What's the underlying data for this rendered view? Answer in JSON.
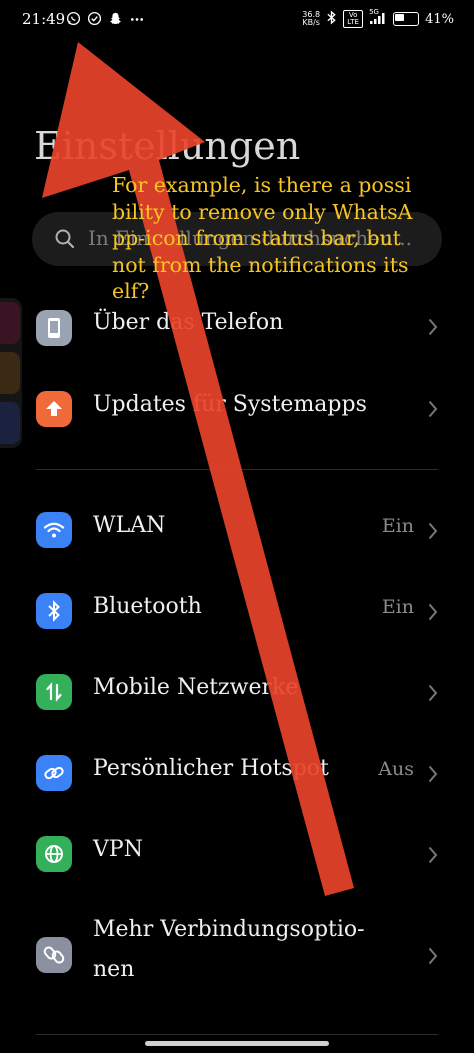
{
  "status_bar": {
    "time": "21:49",
    "net_speed_value": "36.8",
    "net_speed_unit": "KB/s",
    "volte": "Vo LTE",
    "signal": "5G",
    "battery": "41%",
    "battery_level": 0.41,
    "left_icons": [
      "whatsapp-icon",
      "check-circle-icon",
      "snapchat-icon",
      "more-dots-icon"
    ],
    "right_icons": [
      "bluetooth-icon",
      "wifi-icon",
      "signal-icon",
      "battery-icon"
    ]
  },
  "page": {
    "title": "Einstellungen"
  },
  "search": {
    "placeholder": "In Einstellungen durchsuchen..."
  },
  "groups": [
    {
      "items": [
        {
          "label": "Über das Telefon",
          "icon": "phone-icon",
          "color": "#9aa3b2"
        },
        {
          "label": "Updates für Systemapps",
          "icon": "update-arrow-icon",
          "color": "#f06a3a"
        }
      ]
    },
    {
      "items": [
        {
          "label": "WLAN",
          "value": "Ein",
          "icon": "wifi-icon",
          "color": "#3b82f6"
        },
        {
          "label": "Bluetooth",
          "value": "Ein",
          "icon": "bluetooth-icon",
          "color": "#3b82f6"
        },
        {
          "label": "Mobile Netzwerke",
          "icon": "mobile-data-icon",
          "color": "#34b05a"
        },
        {
          "label": "Persönlicher Hotspot",
          "value": "Aus",
          "icon": "hotspot-link-icon",
          "color": "#3b82f6"
        },
        {
          "label": "VPN",
          "icon": "globe-icon",
          "color": "#34b05a"
        },
        {
          "label": "Mehr Verbindungsoptio-",
          "label2": "nen",
          "icon": "connection-link-icon",
          "color": "#8a90a0"
        }
      ]
    }
  ],
  "annotation": {
    "text": "For example, is there a possibility to remove only WhatsApp-icon from status bar, but not from the notifications itself?",
    "color": "#f7c623",
    "arrow_color": "#e8432a"
  }
}
